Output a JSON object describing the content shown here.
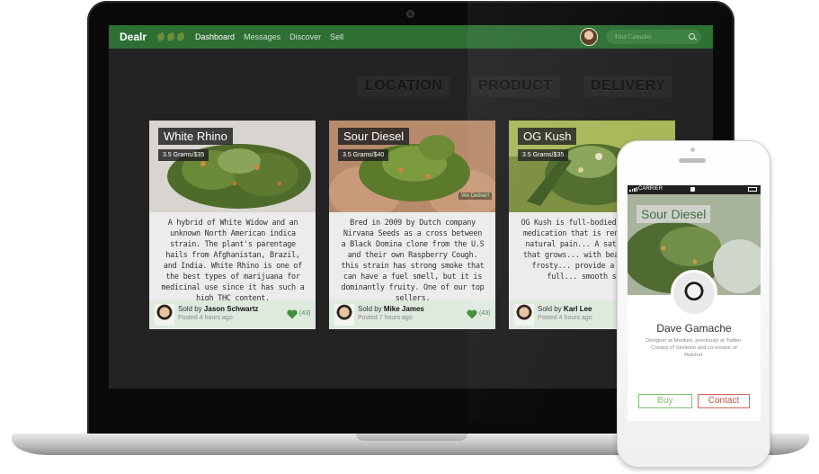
{
  "navbar": {
    "brand": "Dealr",
    "links": [
      "Dashboard",
      "Messages",
      "Discover",
      "Sell"
    ],
    "search_placeholder": "Find Cannabis"
  },
  "filters": [
    "LOCATION",
    "PRODUCT",
    "DELIVERY"
  ],
  "cards": [
    {
      "title": "White Rhino",
      "price": "3.5 Grams/$35",
      "description": "A hybrid of White Widow and an unknown North American indica strain. The plant's parentage hails from Afghanistan, Brazil, and India. White Rhino is one of the best types of marijuana for medicinal use since it has such a high THC content.",
      "sold_by_label": "Sold by",
      "seller": "Jason Schwartz",
      "posted": "Posted 4 hours ago",
      "likes": "(43)"
    },
    {
      "title": "Sour Diesel",
      "price": "3.5 Grams/$40",
      "description": "Bred in 2009 by Dutch company Nirvana Seeds as a cross between a Black Domina clone from the U.S and their own Raspberry Cough. this strain has strong smoke that can have a fuel smell, but it is dominantly fruity. One of our top sellers.",
      "sold_by_label": "Sold by",
      "seller": "Mike James",
      "posted": "Posted 7 hours ago",
      "likes": "(43)",
      "tag": "We Deliver!"
    },
    {
      "title": "OG Kush",
      "price": "3.5 Grams/$35",
      "description": "OG Kush is full-bodied and potent medication that is renowned as a natural pain... A sativa strain that grows... with beautiful red frosty... provide a pleasant full... smooth smoke.",
      "sold_by_label": "Sold by",
      "seller": "Karl Lee",
      "posted": "Posted 4 hours ago",
      "likes": ""
    }
  ],
  "phone": {
    "carrier": "CARRIER",
    "title": "Sour Diesel",
    "name": "Dave Gamache",
    "bio": "Designer at Medium, previously at Twitter. Creator of Skeleton and co-creator of Ratchet.",
    "buy_label": "Buy",
    "contact_label": "Contact"
  },
  "colors": {
    "nav_green": "#2e6f34",
    "buy_green": "#7cc06e",
    "contact_red": "#d26a55"
  }
}
